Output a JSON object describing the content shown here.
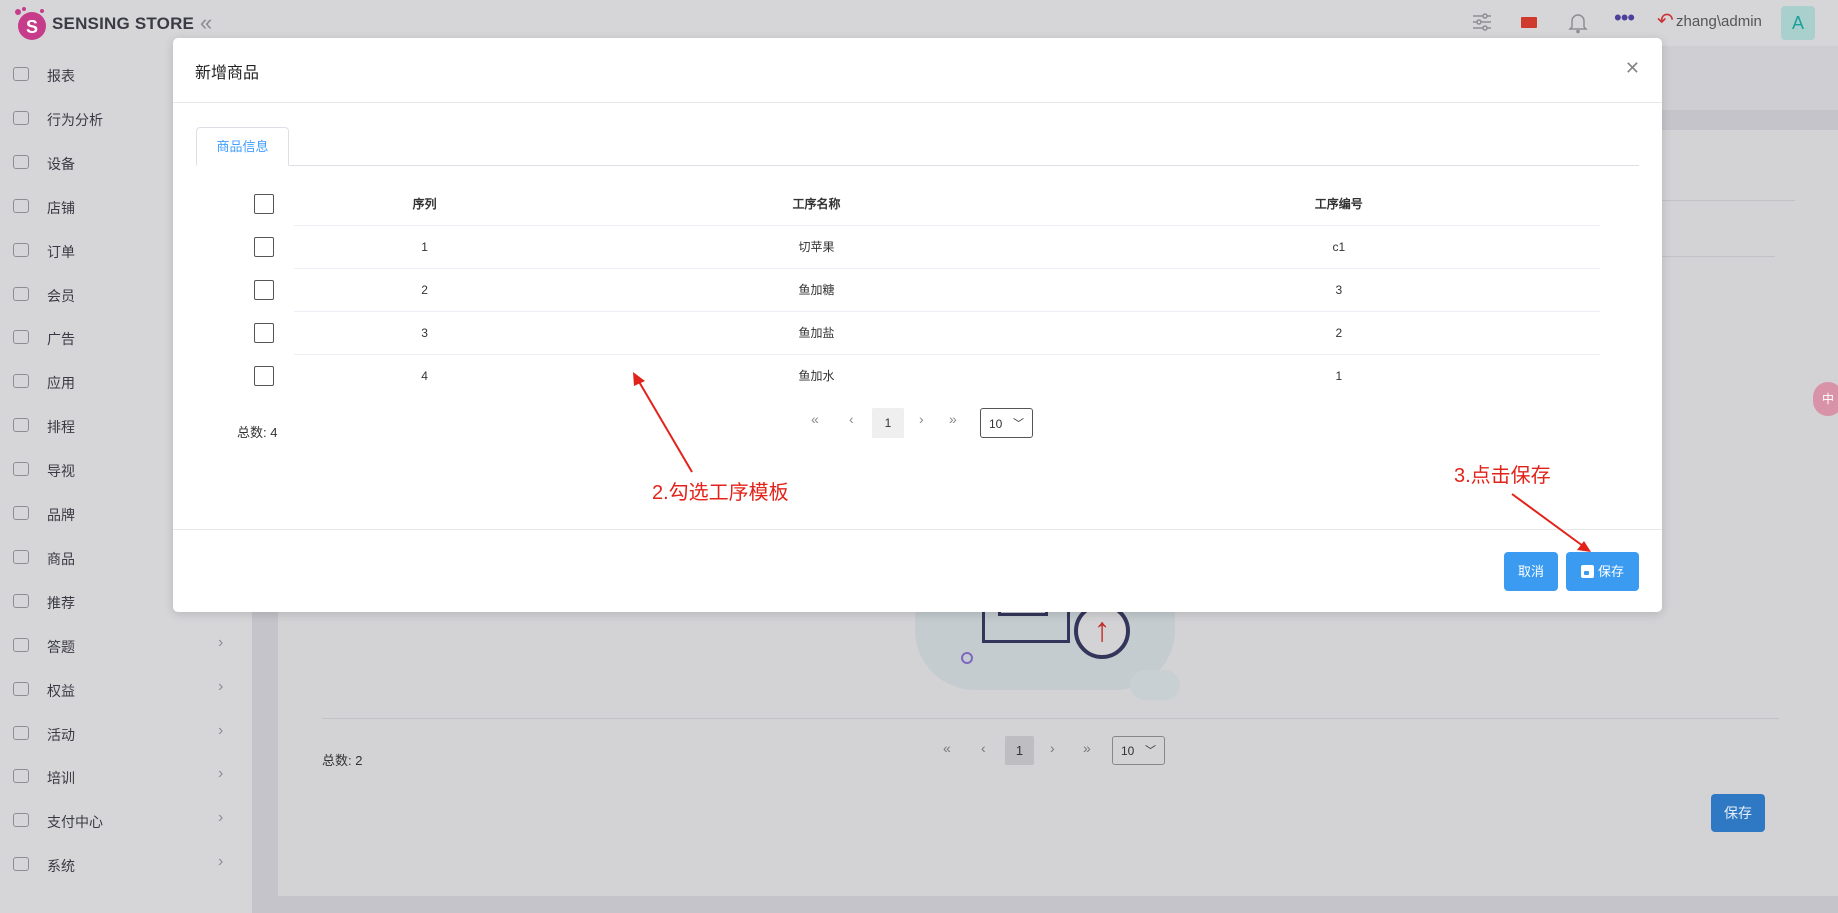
{
  "app": {
    "brand": "SENSING STORE",
    "user": "zhang\\admin",
    "avatar_letter": "A"
  },
  "sidebar": {
    "items": [
      {
        "label": "报表",
        "icon": "dashboard-icon",
        "arrow": false
      },
      {
        "label": "行为分析",
        "icon": "document-icon",
        "arrow": false
      },
      {
        "label": "设备",
        "icon": "device-icon",
        "arrow": false
      },
      {
        "label": "店铺",
        "icon": "store-icon",
        "arrow": false
      },
      {
        "label": "订单",
        "icon": "order-icon",
        "arrow": false
      },
      {
        "label": "会员",
        "icon": "diamond-icon",
        "arrow": false
      },
      {
        "label": "广告",
        "icon": "ad-icon",
        "arrow": false
      },
      {
        "label": "应用",
        "icon": "apps-icon",
        "arrow": false
      },
      {
        "label": "排程",
        "icon": "schedule-icon",
        "arrow": false
      },
      {
        "label": "导视",
        "icon": "navigation-icon",
        "arrow": false
      },
      {
        "label": "品牌",
        "icon": "crown-icon",
        "arrow": false
      },
      {
        "label": "商品",
        "icon": "box-icon",
        "arrow": false
      },
      {
        "label": "推荐",
        "icon": "star-icon",
        "arrow": false
      },
      {
        "label": "答题",
        "icon": "edit-icon",
        "arrow": true
      },
      {
        "label": "权益",
        "icon": "user-icon",
        "arrow": true
      },
      {
        "label": "活动",
        "icon": "flag-icon",
        "arrow": true
      },
      {
        "label": "培训",
        "icon": "graduation-icon",
        "arrow": true
      },
      {
        "label": "支付中心",
        "icon": "payment-icon",
        "arrow": true
      },
      {
        "label": "系统",
        "icon": "gear-icon",
        "arrow": true
      }
    ]
  },
  "background": {
    "total_label": "总数: 2",
    "page": "1",
    "page_size": "10",
    "save_label": "保存"
  },
  "modal": {
    "title": "新增商品",
    "tab_label": "商品信息",
    "columns": [
      "序列",
      "工序名称",
      "工序编号"
    ],
    "rows": [
      {
        "seq": "1",
        "name": "切苹果",
        "code": "c1"
      },
      {
        "seq": "2",
        "name": "鱼加糖",
        "code": "3"
      },
      {
        "seq": "3",
        "name": "鱼加盐",
        "code": "2"
      },
      {
        "seq": "4",
        "name": "鱼加水",
        "code": "1"
      }
    ],
    "total_label": "总数: 4",
    "page": "1",
    "page_size": "10",
    "cancel_label": "取消",
    "save_label": "保存"
  },
  "annotations": {
    "step2": "2.勾选工序模板",
    "step3": "3.点击保存",
    "color": "#e2231a"
  },
  "colors": {
    "primary": "#3a9bf0",
    "tab_active": "#409eff"
  }
}
